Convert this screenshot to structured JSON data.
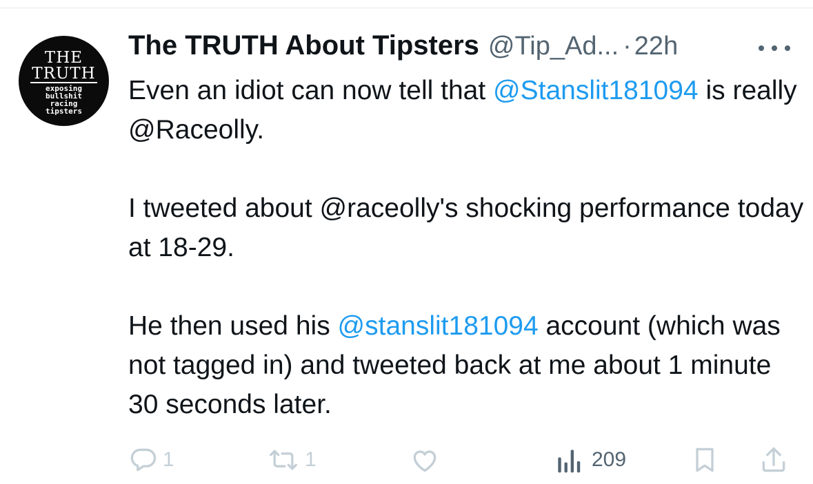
{
  "avatar": {
    "line1": "THE",
    "line2": "TRUTH",
    "line3": "exposing",
    "line4": "bullshit",
    "line5": "racing",
    "line6": "tipsters"
  },
  "tweet": {
    "display_name": "The TRUTH About Tipsters",
    "handle": "@Tip_Ad...",
    "separator": "·",
    "time": "22h",
    "p1_a": "Even an idiot can now tell that ",
    "p1_mention": "@Stanslit181094",
    "p1_b": " is really @Raceolly.",
    "p2": "I tweeted about @raceolly's shocking performance today at 18-29.",
    "p3_a": "He then used his ",
    "p3_mention": "@stanslit181094",
    "p3_b": " account (which was not tagged in) and tweeted back at me about 1 minute 30 seconds later."
  },
  "actions": {
    "reply_count": "1",
    "retweet_count": "1",
    "views_count": "209"
  },
  "icons": {
    "reply": "reply-icon",
    "retweet": "retweet-icon",
    "like": "heart-icon",
    "views": "views-chart-icon",
    "bookmark": "bookmark-icon",
    "share": "share-icon",
    "more": "more-icon"
  },
  "colors": {
    "mention": "#1d9bf0",
    "muted": "#536471",
    "faded": "#c4cfd6"
  }
}
